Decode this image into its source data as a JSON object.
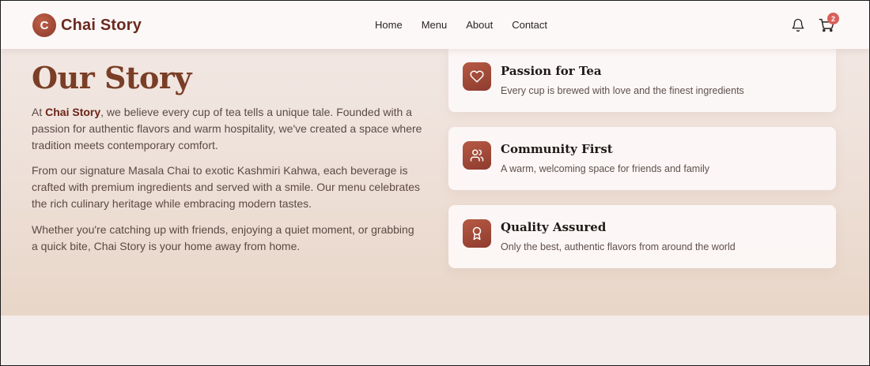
{
  "brand": {
    "badge_letter": "C",
    "name": "Chai Story"
  },
  "nav": {
    "items": [
      {
        "label": "Home"
      },
      {
        "label": "Menu"
      },
      {
        "label": "About"
      },
      {
        "label": "Contact"
      }
    ]
  },
  "header_actions": {
    "notification_icon": "bell-icon",
    "cart_icon": "cart-icon",
    "cart_count": "2"
  },
  "story": {
    "title": "Our Story",
    "p1_prefix": "At ",
    "p1_brand": "Chai Story",
    "p1_rest": ", we believe every cup of tea tells a unique tale. Founded with a passion for authentic flavors and warm hospitality, we've created a space where tradition meets contemporary comfort.",
    "p2": "From our signature Masala Chai to exotic Kashmiri Kahwa, each beverage is crafted with premium ingredients and served with a smile. Our menu celebrates the rich culinary heritage while embracing modern tastes.",
    "p3": "Whether you're catching up with friends, enjoying a quiet moment, or grabbing a quick bite, Chai Story is your home away from home."
  },
  "features": [
    {
      "icon": "heart-icon",
      "title": "Passion for Tea",
      "description": "Every cup is brewed with love and the finest ingredients"
    },
    {
      "icon": "users-icon",
      "title": "Community First",
      "description": "A warm, welcoming space for friends and family"
    },
    {
      "icon": "award-icon",
      "title": "Quality Assured",
      "description": "Only the best, authentic flavors from around the world"
    }
  ],
  "colors": {
    "brand_primary": "#6b2a1e",
    "accent": "#8e3b2e",
    "title": "#7a3e26",
    "badge": "#d9605a"
  }
}
